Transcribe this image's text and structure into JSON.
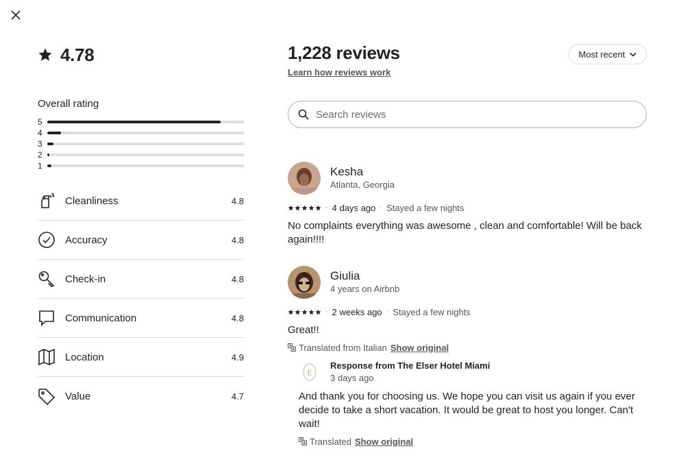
{
  "header": {
    "close_icon": "close-icon"
  },
  "summary": {
    "rating": "4.78",
    "overall_title": "Overall rating",
    "distribution": [
      {
        "label": "5",
        "fraction": 0.88
      },
      {
        "label": "4",
        "fraction": 0.07
      },
      {
        "label": "3",
        "fraction": 0.03
      },
      {
        "label": "2",
        "fraction": 0.01
      },
      {
        "label": "1",
        "fraction": 0.02
      }
    ],
    "categories": [
      {
        "icon": "spray-bottle-icon",
        "label": "Cleanliness",
        "score": "4.8"
      },
      {
        "icon": "check-circle-icon",
        "label": "Accuracy",
        "score": "4.8"
      },
      {
        "icon": "key-icon",
        "label": "Check-in",
        "score": "4.8"
      },
      {
        "icon": "chat-bubble-icon",
        "label": "Communication",
        "score": "4.8"
      },
      {
        "icon": "map-icon",
        "label": "Location",
        "score": "4.9"
      },
      {
        "icon": "tag-icon",
        "label": "Value",
        "score": "4.7"
      }
    ]
  },
  "reviews_header": {
    "count": "1,228 reviews",
    "learn_link": "Learn how reviews work",
    "sort_label": "Most recent",
    "search_placeholder": "Search reviews"
  },
  "reviews": [
    {
      "name": "Kesha",
      "sub": "Atlanta, Georgia",
      "stars": 5,
      "when": "4 days ago",
      "stay": "Stayed a few nights",
      "text": "No complaints everything was awesome , clean and comfortable! Will be back again!!!!"
    },
    {
      "name": "Giulia",
      "sub": "4 years on Airbnb",
      "stars": 5,
      "when": "2 weeks ago",
      "stay": "Stayed a few nights",
      "text": "Great!!",
      "translated_label": "Translated from Italian",
      "show_original": "Show original",
      "response": {
        "logo_letter": "E",
        "title": "Response from The Elser Hotel Miami",
        "date": "3 days ago",
        "text": "And thank you for choosing us. We hope you can visit us again if you ever decide to take a short vacation. It would be great to host you longer. Can't wait!",
        "translated_label": "Translated",
        "show_original": "Show original"
      }
    }
  ],
  "colors": {
    "text": "#222222",
    "muted": "#555555",
    "divider": "#dddddd",
    "bar_track": "#dddddd",
    "bar_fill": "#222222"
  }
}
